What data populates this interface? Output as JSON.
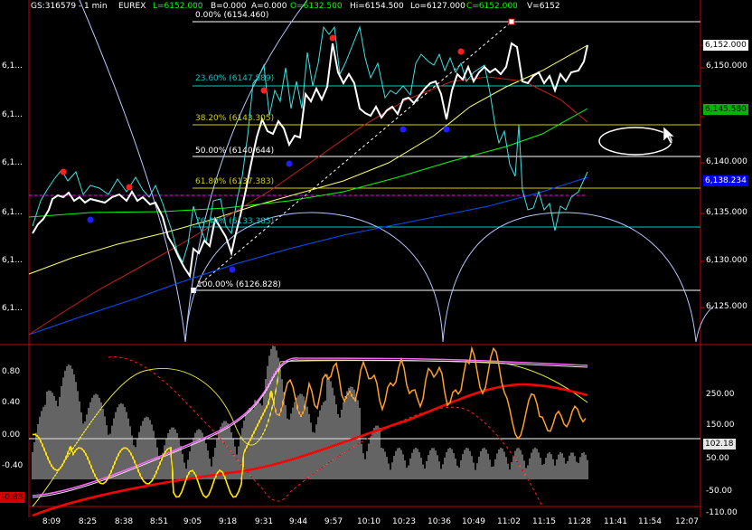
{
  "header": {
    "symbol": "GS:316579 - 1 min",
    "exchange": "EUREX",
    "last": "L=6152.000",
    "bid": "B=0.000",
    "ask": "A=0.000",
    "open": "O=6132.500",
    "high": "Hi=6154.500",
    "low": "Lo=6127.000",
    "close": "C=6152.000",
    "volume": "V=6152"
  },
  "colors": {
    "last": "#00ff00",
    "open": "#00ff00",
    "close": "#00ff00",
    "badge_green": "#00b400",
    "badge_blue": "#0000ff",
    "badge_red": "#d40000",
    "badge_gray": "#e6e6e6"
  },
  "price_axis": {
    "ticks": [
      "6,152.000",
      "6,150.000",
      "6,140.000",
      "6,135.000",
      "6,130.000",
      "6,125.000"
    ],
    "badges": {
      "last": "6,152.000",
      "green": "6,145.580",
      "blue": "6,138.234"
    }
  },
  "left_axis_price": [
    "6,1...",
    "6,1...",
    "6,1...",
    "6,1...",
    "6,1...",
    "6,1..."
  ],
  "fib_levels": [
    {
      "label": "0.00% (6154.460)",
      "color": "#ffffff"
    },
    {
      "label": "23.60% (6147.589)",
      "color": "#00c8c8"
    },
    {
      "label": "38.20% (6143.305)",
      "color": "#d2d200"
    },
    {
      "label": "50.00% (6140.644)",
      "color": "#ffffff"
    },
    {
      "label": "61.80% (6137.383)",
      "color": "#d2d200"
    },
    {
      "label": "76.40% (6133.385)",
      "color": "#00c8c8"
    },
    {
      "label": "100.00% (6126.828)",
      "color": "#ffffff"
    }
  ],
  "indicator_axis": {
    "left": [
      "0.80",
      "0.40",
      "0.00",
      "-0.40",
      "-0.83"
    ],
    "right": [
      "250.00",
      "150.00",
      "102.18",
      "50.00",
      "-50.00",
      "-110.00"
    ],
    "left_badge": "-0.83",
    "right_badge": "102.18"
  },
  "time_axis": [
    "8:09",
    "8:25",
    "8:38",
    "8:51",
    "9:05",
    "9:18",
    "9:31",
    "9:44",
    "9:57",
    "10:10",
    "10:23",
    "10:36",
    "10:49",
    "11:02",
    "11:15",
    "11:28",
    "11:41",
    "11:54",
    "12:07"
  ]
}
